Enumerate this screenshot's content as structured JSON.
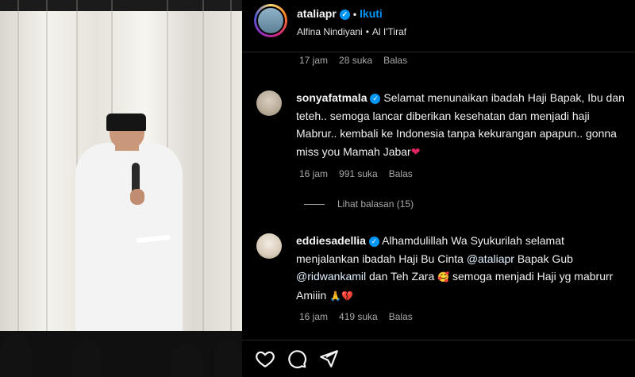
{
  "header": {
    "username": "ataliapr",
    "follow_label": "Ikuti",
    "subtitle_user": "Alfina Nindiyani",
    "subtitle_audio": "Al I'Tiraf"
  },
  "top_meta": {
    "time": "17 jam",
    "likes": "28 suka",
    "reply": "Balas"
  },
  "comments": [
    {
      "username": "sonyafatmala",
      "text": "Selamat menunaikan ibadah Haji Bapak, Ibu dan teteh.. semoga lancar diberikan kesehatan dan menjadi haji Mabrur.. kembali ke Indonesia tanpa kekurangan apapun.. gonna miss you Mamah Jabar",
      "time": "16 jam",
      "likes": "991 suka",
      "reply": "Balas",
      "view_replies": "Lihat balasan (15)"
    },
    {
      "username": "eddiesadellia",
      "text_1": "Alhamdulillah Wa Syukurilah selamat menjalankan ibadah Haji Bu Cinta",
      "mention_1": "@ataliapr",
      "text_2": "Bapak Gub",
      "mention_2": "@ridwankamil",
      "text_3": "dan Teh Zara",
      "text_4": "semoga menjadi Haji yg mabrurr Amiiin",
      "time": "16 jam",
      "likes": "419 suka",
      "reply": "Balas"
    }
  ],
  "colors": {
    "accent": "#0095f6",
    "background": "#000000",
    "muted": "#a8a8a8"
  },
  "icons": [
    "verified-badge-icon",
    "heart-icon",
    "comment-icon",
    "share-icon"
  ]
}
